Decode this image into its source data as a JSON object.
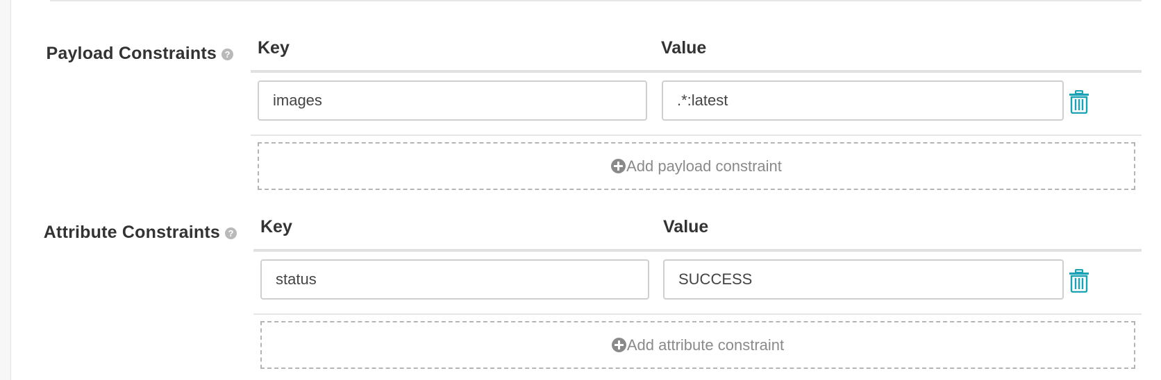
{
  "payload": {
    "label": "Payload Constraints",
    "help_icon": "?",
    "key_header": "Key",
    "value_header": "Value",
    "rows": [
      {
        "key": "images",
        "value": ".*:latest"
      }
    ],
    "add_label": "Add payload constraint",
    "icons": {
      "help": "question-circle-icon",
      "delete": "trash-icon",
      "add": "plus-circle-icon"
    }
  },
  "attribute": {
    "label": "Attribute Constraints",
    "help_icon": "?",
    "key_header": "Key",
    "value_header": "Value",
    "rows": [
      {
        "key": "status",
        "value": "SUCCESS"
      }
    ],
    "add_label": "Add attribute constraint",
    "icons": {
      "help": "question-circle-icon",
      "delete": "trash-icon",
      "add": "plus-circle-icon"
    }
  },
  "colors": {
    "accent": "#1ba3b5",
    "text": "#333333",
    "muted": "#8a8a8a"
  }
}
